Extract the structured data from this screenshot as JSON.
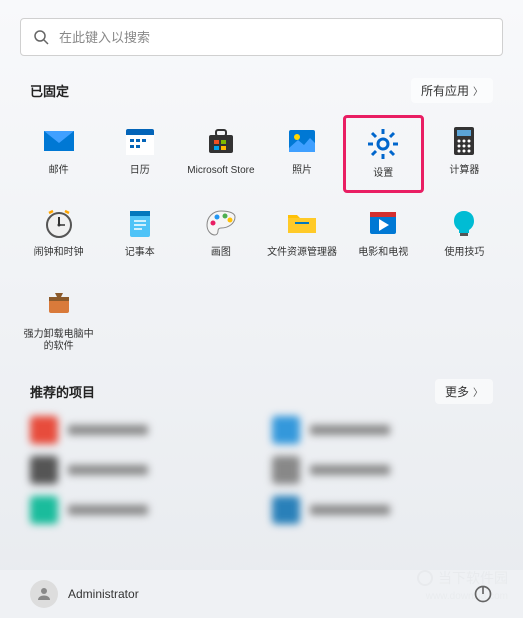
{
  "search": {
    "placeholder": "在此键入以搜索"
  },
  "sections": {
    "pinned": {
      "title": "已固定",
      "action": "所有应用"
    },
    "recommended": {
      "title": "推荐的项目",
      "action": "更多"
    }
  },
  "apps": [
    {
      "label": "邮件",
      "icon": "mail"
    },
    {
      "label": "日历",
      "icon": "calendar"
    },
    {
      "label": "Microsoft Store",
      "icon": "store"
    },
    {
      "label": "照片",
      "icon": "photos"
    },
    {
      "label": "设置",
      "icon": "settings",
      "highlighted": true
    },
    {
      "label": "计算器",
      "icon": "calculator"
    },
    {
      "label": "闹钟和时钟",
      "icon": "clock"
    },
    {
      "label": "记事本",
      "icon": "notepad"
    },
    {
      "label": "画图",
      "icon": "paint"
    },
    {
      "label": "文件资源管理器",
      "icon": "explorer"
    },
    {
      "label": "电影和电视",
      "icon": "movies"
    },
    {
      "label": "使用技巧",
      "icon": "tips"
    },
    {
      "label": "强力卸载电脑中的软件",
      "icon": "uninstall"
    }
  ],
  "user": {
    "name": "Administrator"
  },
  "watermark": {
    "main": "当下软件园",
    "sub": "www.downxia.com"
  }
}
